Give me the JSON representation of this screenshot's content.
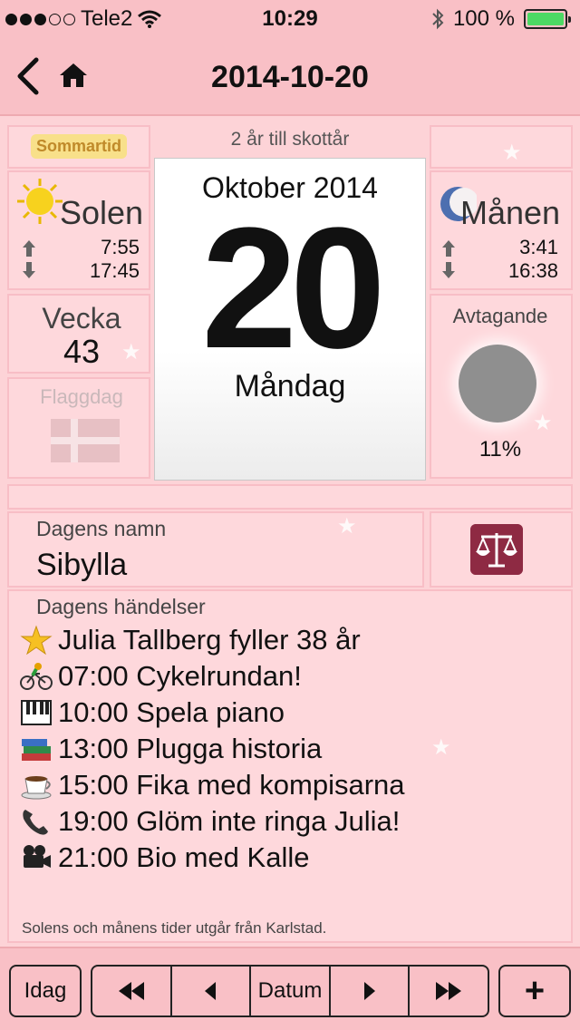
{
  "status": {
    "carrier": "Tele2",
    "time": "10:29",
    "battery": "100 %"
  },
  "nav": {
    "title": "2014-10-20"
  },
  "info": {
    "dst_badge": "Sommartid",
    "leap_text": "2 år till skottår",
    "sun": {
      "title": "Solen",
      "rise": "7:55",
      "set": "17:45"
    },
    "moon": {
      "title": "Månen",
      "rise": "3:41",
      "set": "16:38"
    },
    "week": {
      "label": "Vecka",
      "number": "43"
    },
    "flag": {
      "label": "Flaggdag"
    },
    "calendar": {
      "month": "Oktober 2014",
      "day": "20",
      "weekday": "Måndag"
    },
    "moon_phase": {
      "label": "Avtagande",
      "percent": "11%"
    }
  },
  "name_day": {
    "label": "Dagens namn",
    "value": "Sibylla"
  },
  "events": {
    "label": "Dagens händelser",
    "items": [
      {
        "icon": "star-icon",
        "text": "Julia Tallberg fyller 38 år"
      },
      {
        "icon": "bicycle-icon",
        "text": "07:00 Cykelrundan!"
      },
      {
        "icon": "piano-icon",
        "text": "10:00 Spela piano"
      },
      {
        "icon": "books-icon",
        "text": "13:00 Plugga historia"
      },
      {
        "icon": "coffee-icon",
        "text": "15:00 Fika med kompisarna"
      },
      {
        "icon": "phone-icon",
        "text": "19:00 Glöm inte ringa Julia!"
      },
      {
        "icon": "camera-icon",
        "text": "21:00 Bio med Kalle"
      }
    ]
  },
  "footnote": "Solens och månens tider utgår från Karlstad.",
  "toolbar": {
    "today": "Idag",
    "date": "Datum",
    "add": "+"
  },
  "colors": {
    "background": "#fdd3d7",
    "bar": "#f9c0c6",
    "battery": "#4cd964",
    "zodiac": "#8e2a43",
    "dst_badge": "#f8e08a"
  }
}
